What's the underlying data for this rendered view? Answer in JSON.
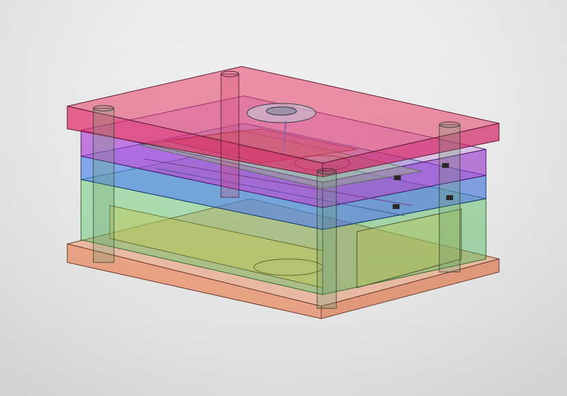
{
  "scene": {
    "subject": "mold-assembly",
    "render_style": "translucent-shaded-wireframe",
    "plates": [
      {
        "name": "top-clamp-plate",
        "color": "#e0206a"
      },
      {
        "name": "a-plate",
        "color": "#a92fd6"
      },
      {
        "name": "runner-plate",
        "color": "#2f6fe0"
      },
      {
        "name": "b-plate",
        "color": "#3fc05a"
      },
      {
        "name": "support-plate",
        "color": "#8cc74a"
      },
      {
        "name": "bottom-clamp-plate",
        "color": "#f0a07a"
      }
    ],
    "background_color": "#e8e8e8"
  }
}
